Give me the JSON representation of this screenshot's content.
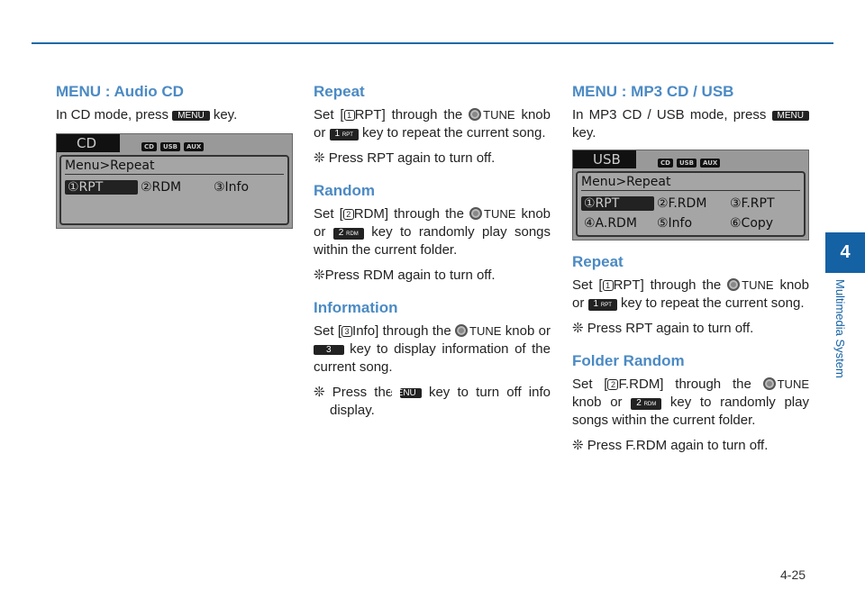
{
  "page_number": "4-25",
  "chapter": {
    "number": "4",
    "title": "Multimedia System"
  },
  "colors": {
    "accent": "#1461a4",
    "heading": "#4b8ac4"
  },
  "tune": "TUNE",
  "col1": {
    "title": "MENU : Audio CD",
    "p1a": "In CD mode, press",
    "p1key": "MENU",
    "p1b": "key.",
    "screen": {
      "tab": "CD",
      "badges": [
        "CD",
        "USB",
        "AUX"
      ],
      "title": "Menu>Repeat",
      "rows": [
        [
          "①RPT",
          "②RDM",
          "③Info"
        ]
      ]
    }
  },
  "col2": {
    "repeat": {
      "title": "Repeat",
      "a": "Set [",
      "circ": "1",
      "b": "RPT] through the",
      "c": "knob or",
      "key": "1",
      "keysub": "RPT",
      "d": "key to repeat the current song.",
      "note": "❊ Press RPT again to turn off."
    },
    "random": {
      "title": "Random",
      "a": "Set [",
      "circ": "2",
      "b": "RDM] through the",
      "c": "knob or",
      "key": "2",
      "keysub": "RDM",
      "d": "key to randomly play songs within the current folder.",
      "note": "❊Press RDM again to turn off."
    },
    "info": {
      "title": "Information",
      "a": "Set [",
      "circ": "3",
      "b": "Info] through the",
      "c": "knob or",
      "key": "3",
      "d": "key to display information of the current song.",
      "note_a": "❊ Press the",
      "note_key": "MENU",
      "note_b": "key to turn off info display."
    }
  },
  "col3": {
    "title": "MENU : MP3 CD / USB",
    "p1a": "In MP3 CD / USB mode, press",
    "p1key": "MENU",
    "p1b": "key.",
    "screen": {
      "tab": "USB",
      "badges": [
        "CD",
        "USB",
        "AUX"
      ],
      "title": "Menu>Repeat",
      "rows": [
        [
          "①RPT",
          "②F.RDM",
          "③F.RPT"
        ],
        [
          "④A.RDM",
          "⑤Info",
          "⑥Copy"
        ]
      ]
    },
    "repeat": {
      "title": "Repeat",
      "a": "Set [",
      "circ": "1",
      "b": "RPT] through the",
      "c": "knob or",
      "key": "1",
      "keysub": "RPT",
      "d": "key to repeat the current song.",
      "note": "❊ Press RPT again to turn off."
    },
    "frandom": {
      "title": "Folder Random",
      "a": "Set [",
      "circ": "2",
      "b": "F.RDM] through the",
      "c": "knob or",
      "key": "2",
      "keysub": "RDM",
      "d": "key to randomly play songs within the current folder.",
      "note": "❊ Press F.RDM again to turn off."
    }
  }
}
